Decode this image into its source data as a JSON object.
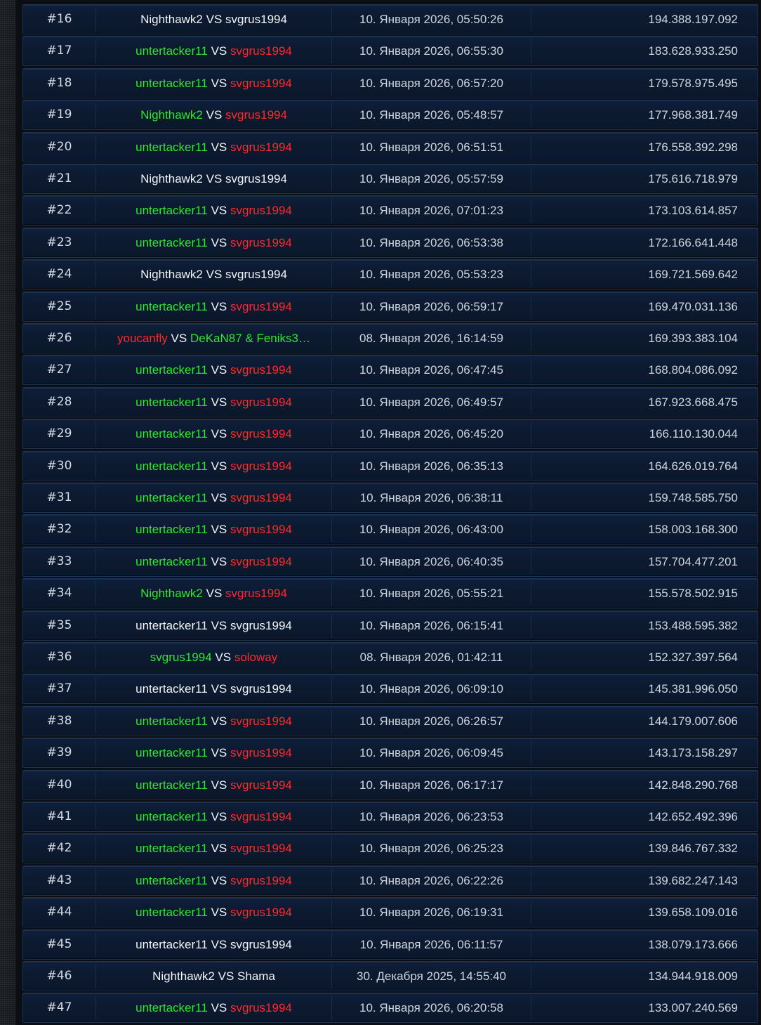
{
  "vs_label": "VS",
  "colors": {
    "winner": "#2ee82e",
    "loser": "#ff2a2a",
    "neutral": "#f2f4f7"
  },
  "rows": [
    {
      "rank": "#16",
      "p1": "Nighthawk2",
      "p1_color": "white",
      "p2": "svgrus1994",
      "p2_color": "white",
      "date": "10. Января 2026, 05:50:26",
      "score": "194.388.197.092"
    },
    {
      "rank": "#17",
      "p1": "untertacker11",
      "p1_color": "green",
      "p2": "svgrus1994",
      "p2_color": "red",
      "date": "10. Января 2026, 06:55:30",
      "score": "183.628.933.250"
    },
    {
      "rank": "#18",
      "p1": "untertacker11",
      "p1_color": "green",
      "p2": "svgrus1994",
      "p2_color": "red",
      "date": "10. Января 2026, 06:57:20",
      "score": "179.578.975.495"
    },
    {
      "rank": "#19",
      "p1": "Nighthawk2",
      "p1_color": "green",
      "p2": "svgrus1994",
      "p2_color": "red",
      "date": "10. Января 2026, 05:48:57",
      "score": "177.968.381.749"
    },
    {
      "rank": "#20",
      "p1": "untertacker11",
      "p1_color": "green",
      "p2": "svgrus1994",
      "p2_color": "red",
      "date": "10. Января 2026, 06:51:51",
      "score": "176.558.392.298"
    },
    {
      "rank": "#21",
      "p1": "Nighthawk2",
      "p1_color": "white",
      "p2": "svgrus1994",
      "p2_color": "white",
      "date": "10. Января 2026, 05:57:59",
      "score": "175.616.718.979"
    },
    {
      "rank": "#22",
      "p1": "untertacker11",
      "p1_color": "green",
      "p2": "svgrus1994",
      "p2_color": "red",
      "date": "10. Января 2026, 07:01:23",
      "score": "173.103.614.857"
    },
    {
      "rank": "#23",
      "p1": "untertacker11",
      "p1_color": "green",
      "p2": "svgrus1994",
      "p2_color": "red",
      "date": "10. Января 2026, 06:53:38",
      "score": "172.166.641.448"
    },
    {
      "rank": "#24",
      "p1": "Nighthawk2",
      "p1_color": "white",
      "p2": "svgrus1994",
      "p2_color": "white",
      "date": "10. Января 2026, 05:53:23",
      "score": "169.721.569.642"
    },
    {
      "rank": "#25",
      "p1": "untertacker11",
      "p1_color": "green",
      "p2": "svgrus1994",
      "p2_color": "red",
      "date": "10. Января 2026, 06:59:17",
      "score": "169.470.031.136"
    },
    {
      "rank": "#26",
      "p1": "youcanfly",
      "p1_color": "red",
      "p2": "DeKaN87 & Feniks3…",
      "p2_color": "green",
      "date": "08. Января 2026, 16:14:59",
      "score": "169.393.383.104"
    },
    {
      "rank": "#27",
      "p1": "untertacker11",
      "p1_color": "green",
      "p2": "svgrus1994",
      "p2_color": "red",
      "date": "10. Января 2026, 06:47:45",
      "score": "168.804.086.092"
    },
    {
      "rank": "#28",
      "p1": "untertacker11",
      "p1_color": "green",
      "p2": "svgrus1994",
      "p2_color": "red",
      "date": "10. Января 2026, 06:49:57",
      "score": "167.923.668.475"
    },
    {
      "rank": "#29",
      "p1": "untertacker11",
      "p1_color": "green",
      "p2": "svgrus1994",
      "p2_color": "red",
      "date": "10. Января 2026, 06:45:20",
      "score": "166.110.130.044"
    },
    {
      "rank": "#30",
      "p1": "untertacker11",
      "p1_color": "green",
      "p2": "svgrus1994",
      "p2_color": "red",
      "date": "10. Января 2026, 06:35:13",
      "score": "164.626.019.764"
    },
    {
      "rank": "#31",
      "p1": "untertacker11",
      "p1_color": "green",
      "p2": "svgrus1994",
      "p2_color": "red",
      "date": "10. Января 2026, 06:38:11",
      "score": "159.748.585.750"
    },
    {
      "rank": "#32",
      "p1": "untertacker11",
      "p1_color": "green",
      "p2": "svgrus1994",
      "p2_color": "red",
      "date": "10. Января 2026, 06:43:00",
      "score": "158.003.168.300"
    },
    {
      "rank": "#33",
      "p1": "untertacker11",
      "p1_color": "green",
      "p2": "svgrus1994",
      "p2_color": "red",
      "date": "10. Января 2026, 06:40:35",
      "score": "157.704.477.201"
    },
    {
      "rank": "#34",
      "p1": "Nighthawk2",
      "p1_color": "green",
      "p2": "svgrus1994",
      "p2_color": "red",
      "date": "10. Января 2026, 05:55:21",
      "score": "155.578.502.915"
    },
    {
      "rank": "#35",
      "p1": "untertacker11",
      "p1_color": "white",
      "p2": "svgrus1994",
      "p2_color": "white",
      "date": "10. Января 2026, 06:15:41",
      "score": "153.488.595.382"
    },
    {
      "rank": "#36",
      "p1": "svgrus1994",
      "p1_color": "green",
      "p2": "soloway",
      "p2_color": "red",
      "date": "08. Января 2026, 01:42:11",
      "score": "152.327.397.564"
    },
    {
      "rank": "#37",
      "p1": "untertacker11",
      "p1_color": "white",
      "p2": "svgrus1994",
      "p2_color": "white",
      "date": "10. Января 2026, 06:09:10",
      "score": "145.381.996.050"
    },
    {
      "rank": "#38",
      "p1": "untertacker11",
      "p1_color": "green",
      "p2": "svgrus1994",
      "p2_color": "red",
      "date": "10. Января 2026, 06:26:57",
      "score": "144.179.007.606"
    },
    {
      "rank": "#39",
      "p1": "untertacker11",
      "p1_color": "green",
      "p2": "svgrus1994",
      "p2_color": "red",
      "date": "10. Января 2026, 06:09:45",
      "score": "143.173.158.297"
    },
    {
      "rank": "#40",
      "p1": "untertacker11",
      "p1_color": "green",
      "p2": "svgrus1994",
      "p2_color": "red",
      "date": "10. Января 2026, 06:17:17",
      "score": "142.848.290.768"
    },
    {
      "rank": "#41",
      "p1": "untertacker11",
      "p1_color": "green",
      "p2": "svgrus1994",
      "p2_color": "red",
      "date": "10. Января 2026, 06:23:53",
      "score": "142.652.492.396"
    },
    {
      "rank": "#42",
      "p1": "untertacker11",
      "p1_color": "green",
      "p2": "svgrus1994",
      "p2_color": "red",
      "date": "10. Января 2026, 06:25:23",
      "score": "139.846.767.332"
    },
    {
      "rank": "#43",
      "p1": "untertacker11",
      "p1_color": "green",
      "p2": "svgrus1994",
      "p2_color": "red",
      "date": "10. Января 2026, 06:22:26",
      "score": "139.682.247.143"
    },
    {
      "rank": "#44",
      "p1": "untertacker11",
      "p1_color": "green",
      "p2": "svgrus1994",
      "p2_color": "red",
      "date": "10. Января 2026, 06:19:31",
      "score": "139.658.109.016"
    },
    {
      "rank": "#45",
      "p1": "untertacker11",
      "p1_color": "white",
      "p2": "svgrus1994",
      "p2_color": "white",
      "date": "10. Января 2026, 06:11:57",
      "score": "138.079.173.666"
    },
    {
      "rank": "#46",
      "p1": "Nighthawk2",
      "p1_color": "white",
      "p2": "Shama",
      "p2_color": "white",
      "date": "30. Декабря 2025, 14:55:40",
      "score": "134.944.918.009"
    },
    {
      "rank": "#47",
      "p1": "untertacker11",
      "p1_color": "green",
      "p2": "svgrus1994",
      "p2_color": "red",
      "date": "10. Января 2026, 06:20:58",
      "score": "133.007.240.569"
    }
  ]
}
